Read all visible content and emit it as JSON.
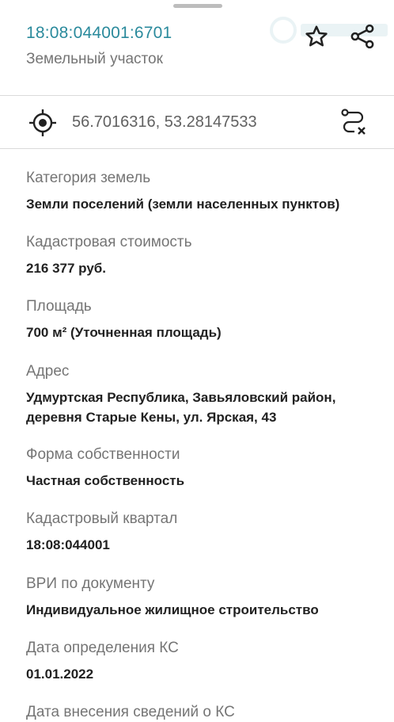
{
  "header": {
    "cadastral_number": "18:08:044001:6701",
    "subtitle": "Земельный участок",
    "icons": [
      "star-icon",
      "share-icon"
    ]
  },
  "coordinates": {
    "text": "56.7016316, 53.28147533",
    "icons": [
      "target-icon",
      "route-icon"
    ]
  },
  "fields": [
    {
      "label": "Категория земель",
      "value": "Земли поселений (земли населенных пунктов)"
    },
    {
      "label": "Кадастровая стоимость",
      "value": "216 377 руб."
    },
    {
      "label": "Площадь",
      "value": "700 м² (Уточненная площадь)"
    },
    {
      "label": "Адрес",
      "value": "Удмуртская Республика, Завьяловский район, деревня Старые Кены, ул. Ярская, 43"
    },
    {
      "label": "Форма собственности",
      "value": "Частная собственность"
    },
    {
      "label": "Кадастровый квартал",
      "value": "18:08:044001"
    },
    {
      "label": "ВРИ по документу",
      "value": "Индивидуальное жилищное строительство"
    },
    {
      "label": "Дата определения КС",
      "value": "01.01.2022"
    },
    {
      "label": "Дата внесения сведений о КС",
      "value": ""
    }
  ],
  "colors": {
    "accent": "#2a8a9c",
    "label": "#757575",
    "value": "#212121",
    "divider": "#dadada"
  }
}
